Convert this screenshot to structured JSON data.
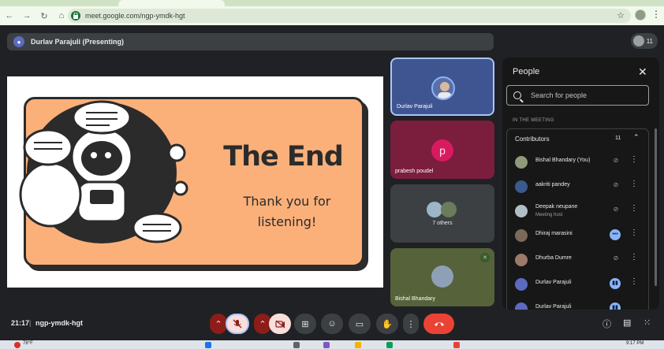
{
  "browser": {
    "url": "meet.google.com/ngp-ymdk-hgt"
  },
  "meet": {
    "presenter_label": "Durlav Parajuli (Presenting)",
    "participant_count": "11",
    "meeting_time": "21:17",
    "meeting_code": "ngp-ymdk-hgt"
  },
  "slide": {
    "title": "The End",
    "subtitle_line1": "Thank you for",
    "subtitle_line2": "listening!",
    "background_color": "#fbb07a"
  },
  "tiles": [
    {
      "name": "Durlav Parajuli"
    },
    {
      "name": "prabesh poudel",
      "initial": "p"
    },
    {
      "name": "7 others"
    },
    {
      "name": "Bishal Bhandary"
    }
  ],
  "people_panel": {
    "title": "People",
    "search_placeholder": "Search for people",
    "section_label": "IN THE MEETING",
    "group_label": "Contributors",
    "group_count": "11",
    "participants": [
      {
        "name": "Bishal Bhandary (You)",
        "role": "",
        "state": "muted"
      },
      {
        "name": "aakriti pandey",
        "role": "",
        "state": "muted"
      },
      {
        "name": "Deepak neupane",
        "role": "Meeting host",
        "state": "muted"
      },
      {
        "name": "Dhiraj marasini",
        "role": "",
        "state": "more"
      },
      {
        "name": "Dhurba Dumre",
        "role": "",
        "state": "muted"
      },
      {
        "name": "Durlav Parajuli",
        "role": "",
        "state": "speaking"
      },
      {
        "name": "Durlav Parajuli",
        "role": "",
        "state": "speaking"
      }
    ]
  },
  "taskbar": {
    "weather": "78°F",
    "time": "9:17 PM"
  },
  "colors": {
    "end_call": "#ea4335",
    "mic_off_bg": "#f9dedc",
    "active_tile_border": "#a8c7fa"
  }
}
